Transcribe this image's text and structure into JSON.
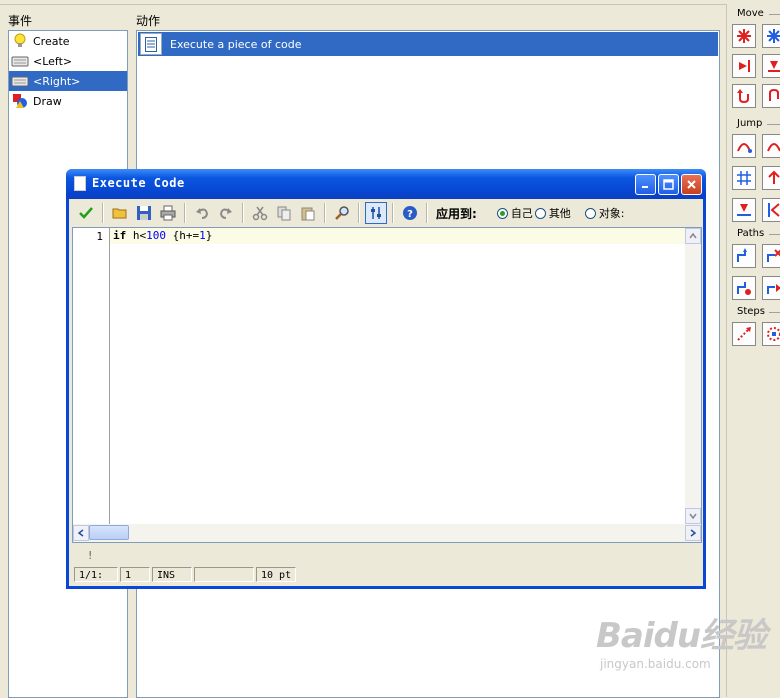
{
  "headers": {
    "events": "事件",
    "actions": "动作"
  },
  "events": [
    {
      "label": "Create",
      "icon": "lightbulb-icon",
      "selected": false
    },
    {
      "label": "<Left>",
      "icon": "keyboard-icon",
      "selected": false
    },
    {
      "label": "<Right>",
      "icon": "keyboard-icon",
      "selected": true
    },
    {
      "label": "Draw",
      "icon": "draw-shapes-icon",
      "selected": false
    }
  ],
  "actions": [
    {
      "label": "Execute a piece of code",
      "icon": "code-page-icon"
    }
  ],
  "palette": {
    "groups": {
      "move": "Move",
      "jump": "Jump",
      "paths": "Paths",
      "steps": "Steps"
    }
  },
  "dialog": {
    "title": "Execute Code",
    "apply_to_label": "应用到:",
    "radio": {
      "self": "自己",
      "other": "其他",
      "object": "对象:"
    },
    "radio_selected": "self",
    "code": {
      "line_number": "1",
      "tokens": {
        "kw_if": "if",
        "var": "h<",
        "n100": "100",
        "body_start": "{h+=",
        "n1": "1",
        "body_end": "}"
      }
    },
    "message": "!",
    "status": {
      "pos": "1/1:",
      "col": "1",
      "mode": "INS",
      "empty": "",
      "size": "10 pt"
    }
  },
  "watermark": {
    "brand": "Baidu经验",
    "url": "jingyan.baidu.com"
  },
  "colors": {
    "selection": "#316ac5",
    "titlebar": "#0a56e0",
    "panel": "#ece9d8"
  }
}
